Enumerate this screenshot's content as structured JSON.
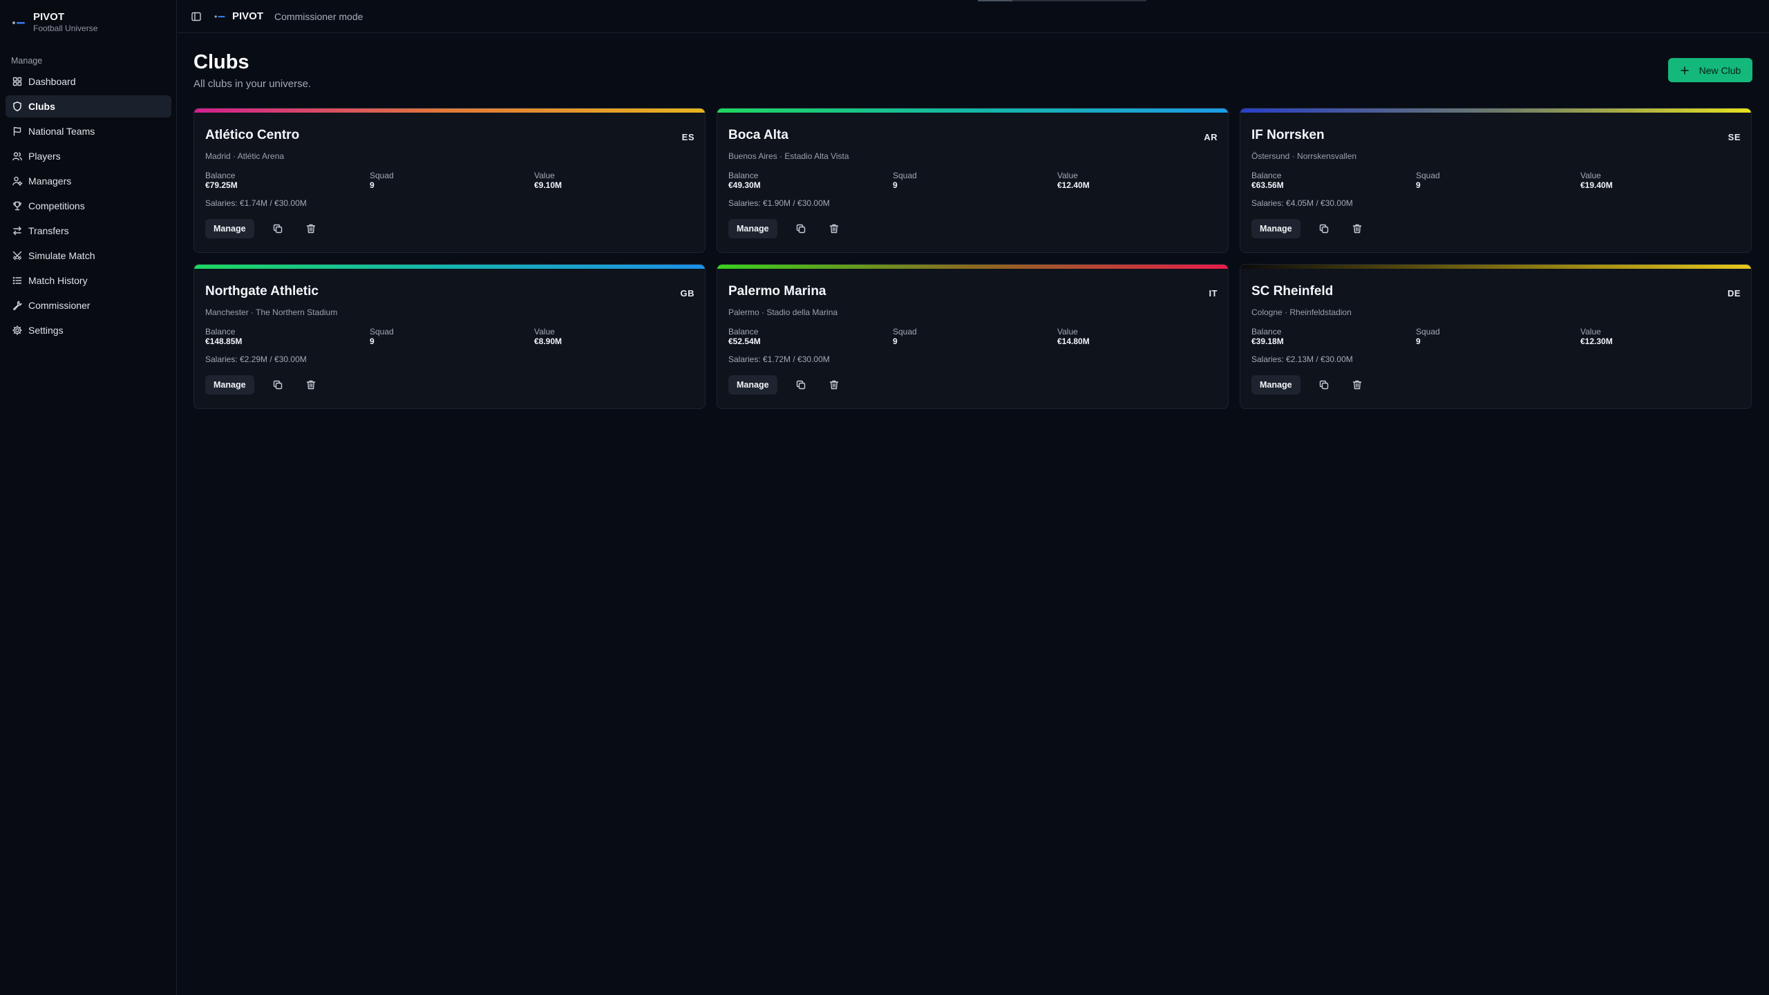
{
  "brand": {
    "name": "PIVOT",
    "subtitle": "Football Universe"
  },
  "sidebar": {
    "section_label": "Manage",
    "items": [
      {
        "label": "Dashboard",
        "icon": "grid-icon",
        "active": false
      },
      {
        "label": "Clubs",
        "icon": "shield-icon",
        "active": true
      },
      {
        "label": "National Teams",
        "icon": "flag-icon",
        "active": false
      },
      {
        "label": "Players",
        "icon": "users-icon",
        "active": false
      },
      {
        "label": "Managers",
        "icon": "user-cog-icon",
        "active": false
      },
      {
        "label": "Competitions",
        "icon": "trophy-icon",
        "active": false
      },
      {
        "label": "Transfers",
        "icon": "arrows-swap-icon",
        "active": false
      },
      {
        "label": "Simulate Match",
        "icon": "swords-icon",
        "active": false
      },
      {
        "label": "Match History",
        "icon": "list-icon",
        "active": false
      },
      {
        "label": "Commissioner",
        "icon": "wrench-icon",
        "active": false
      },
      {
        "label": "Settings",
        "icon": "gear-icon",
        "active": false
      }
    ]
  },
  "topbar": {
    "name": "PIVOT",
    "mode": "Commissioner mode"
  },
  "page": {
    "title": "Clubs",
    "subtitle": "All clubs in your universe.",
    "new_club_label": "New Club"
  },
  "labels": {
    "balance": "Balance",
    "squad": "Squad",
    "value": "Value",
    "manage": "Manage"
  },
  "colors": {
    "accent": "#14b87a"
  },
  "clubs": [
    {
      "name": "Atlético Centro",
      "code": "ES",
      "location": "Madrid · Atlétic Arena",
      "balance": "€79.25M",
      "squad": "9",
      "value": "€9.10M",
      "salaries": "Salaries: €1.74M / €30.00M",
      "bar": [
        "#d11f8f",
        "#e07a3a",
        "#e6b51e"
      ]
    },
    {
      "name": "Boca Alta",
      "code": "AR",
      "location": "Buenos Aires · Estadio Alta Vista",
      "balance": "€49.30M",
      "squad": "9",
      "value": "€12.40M",
      "salaries": "Salaries: €1.90M / €30.00M",
      "bar": [
        "#1ed760",
        "#14b8a6",
        "#1e9be6"
      ]
    },
    {
      "name": "IF Norrsken",
      "code": "SE",
      "location": "Östersund · Norrskensvallen",
      "balance": "€63.56M",
      "squad": "9",
      "value": "€19.40M",
      "salaries": "Salaries: €4.05M / €30.00M",
      "bar": [
        "#2a3fc7",
        "#6b7a6b",
        "#e6e11e"
      ]
    },
    {
      "name": "Northgate Athletic",
      "code": "GB",
      "location": "Manchester · The Northern Stadium",
      "balance": "€148.85M",
      "squad": "9",
      "value": "€8.90M",
      "salaries": "Salaries: €2.29M / €30.00M",
      "bar": [
        "#1ed760",
        "#16b3b0",
        "#1e90e6"
      ]
    },
    {
      "name": "Palermo Marina",
      "code": "IT",
      "location": "Palermo · Stadio della Marina",
      "balance": "€52.54M",
      "squad": "9",
      "value": "€14.80M",
      "salaries": "Salaries: €1.72M / €30.00M",
      "bar": [
        "#3ad11e",
        "#8a6a20",
        "#e61e4a"
      ]
    },
    {
      "name": "SC Rheinfeld",
      "code": "DE",
      "location": "Cologne · Rheinfeldstadion",
      "balance": "€39.18M",
      "squad": "9",
      "value": "€12.30M",
      "salaries": "Salaries: €2.13M / €30.00M",
      "bar": [
        "#0b0b0b",
        "#7a6a10",
        "#e6c81e"
      ]
    }
  ]
}
